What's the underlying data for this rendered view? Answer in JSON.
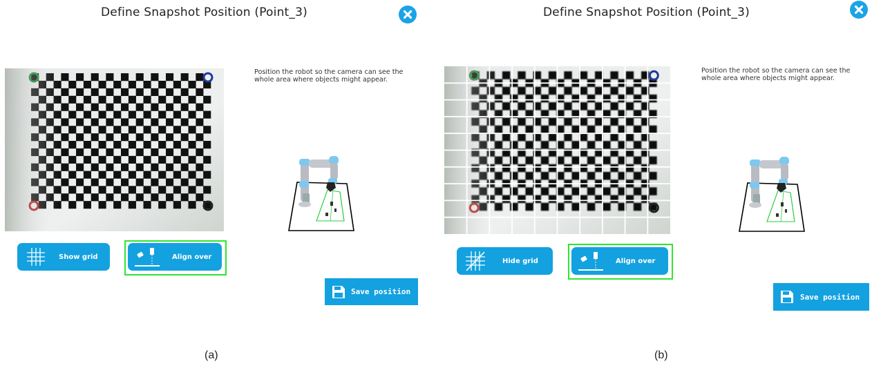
{
  "panels": [
    {
      "id": "a",
      "title": "Define Snapshot Position (Point_3)",
      "instruction": "Position the robot so the camera can see the whole area where objects might appear.",
      "grid_button_label": "Show grid",
      "align_button_label": "Align over",
      "save_button_label": "Save position",
      "caption": "(a)",
      "grid_overlay": false
    },
    {
      "id": "b",
      "title": "Define Snapshot Position (Point_3)",
      "instruction": "Position the robot so the camera can see the whole area where objects might appear.",
      "grid_button_label": "Hide grid",
      "align_button_label": "Align over",
      "save_button_label": "Save position",
      "caption": "(b)",
      "grid_overlay": true
    }
  ],
  "icons": {
    "close": "close-icon",
    "grid": "grid-icon",
    "grid_off": "grid-off-icon",
    "align": "align-over-icon",
    "save": "floppy-disk-icon"
  },
  "colors": {
    "accent": "#13a1e0",
    "highlight": "#2ee52e",
    "close": "#1aa3e8"
  }
}
